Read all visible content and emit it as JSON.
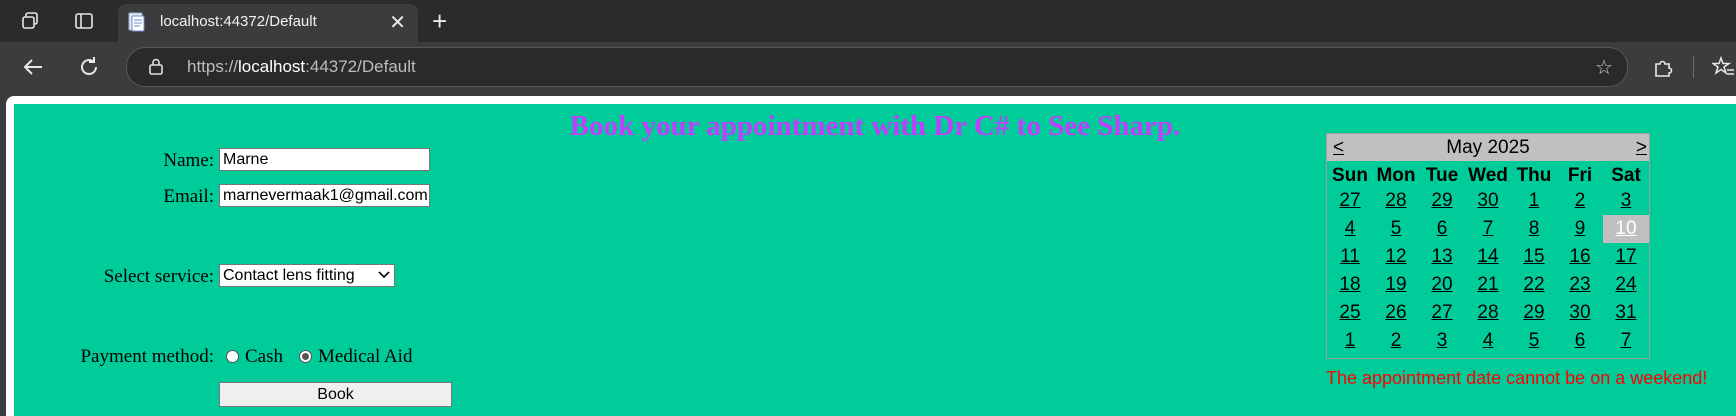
{
  "browser": {
    "tab_title": "localhost:44372/Default",
    "url_scheme": "https://",
    "url_host": "localhost",
    "url_rest": ":44372/Default"
  },
  "page": {
    "heading": "Book your appointment with Dr C# to See Sharp.",
    "name_label": "Name:",
    "name_value": "Marne",
    "email_label": "Email:",
    "email_value": "marnevermaak1@gmail.com",
    "service_label": "Select service:",
    "service_value": "Contact lens fitting",
    "payment_label": "Payment method:",
    "payment_options": [
      {
        "label": "Cash",
        "checked": false
      },
      {
        "label": "Medical Aid",
        "checked": true
      }
    ],
    "book_button": "Book",
    "error": "The appointment date cannot be on a weekend!"
  },
  "calendar": {
    "prev": "<",
    "next": ">",
    "title": "May 2025",
    "weekdays": [
      "Sun",
      "Mon",
      "Tue",
      "Wed",
      "Thu",
      "Fri",
      "Sat"
    ],
    "weeks": [
      [
        "27",
        "28",
        "29",
        "30",
        "1",
        "2",
        "3"
      ],
      [
        "4",
        "5",
        "6",
        "7",
        "8",
        "9",
        "10"
      ],
      [
        "11",
        "12",
        "13",
        "14",
        "15",
        "16",
        "17"
      ],
      [
        "18",
        "19",
        "20",
        "21",
        "22",
        "23",
        "24"
      ],
      [
        "25",
        "26",
        "27",
        "28",
        "29",
        "30",
        "31"
      ],
      [
        "1",
        "2",
        "3",
        "4",
        "5",
        "6",
        "7"
      ]
    ],
    "selected": "10",
    "selected_color": "#c0c0c0"
  },
  "colors": {
    "page_background": "#00cc99",
    "heading": "#bf3fff",
    "error": "#ff0000"
  }
}
